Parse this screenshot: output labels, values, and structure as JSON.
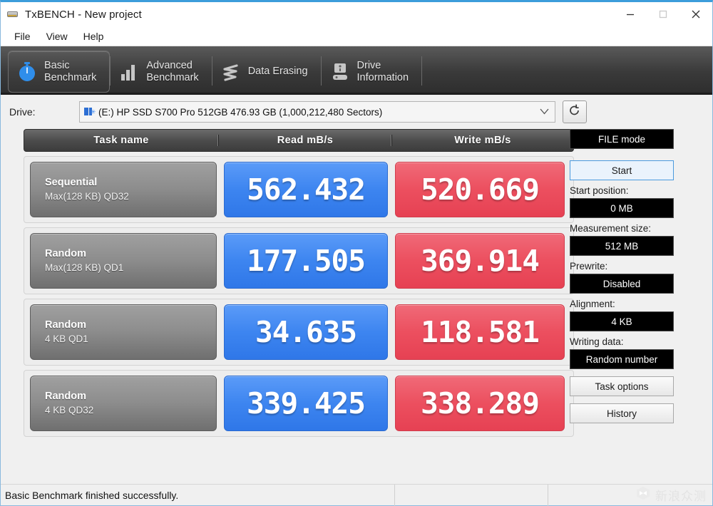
{
  "window": {
    "title": "TxBENCH - New project",
    "app_icon": "hard-disk-icon",
    "controls": {
      "minimize": "minimize-icon",
      "maximize": "maximize-icon",
      "close": "close-icon"
    }
  },
  "menubar": {
    "items": [
      {
        "label": "File"
      },
      {
        "label": "View"
      },
      {
        "label": "Help"
      }
    ]
  },
  "tabs": [
    {
      "label": "Basic\nBenchmark",
      "icon": "stopwatch-icon",
      "active": true
    },
    {
      "label": "Advanced\nBenchmark",
      "icon": "bar-chart-icon",
      "active": false
    },
    {
      "label": "Data Erasing",
      "icon": "scribble-erase-icon",
      "active": false
    },
    {
      "label": "Drive\nInformation",
      "icon": "disk-drive-info-icon",
      "active": false
    }
  ],
  "drive": {
    "label": "Drive:",
    "value": "(E:) HP SSD S700 Pro 512GB  476.93 GB (1,000,212,480 Sectors)",
    "icon": "drive-small-icon",
    "dropdown_icon": "chevron-down-icon",
    "refresh_icon": "refresh-icon"
  },
  "table": {
    "headers": [
      "Task name",
      "Read mB/s",
      "Write mB/s"
    ],
    "rows": [
      {
        "name_line1": "Sequential",
        "name_line2": "Max(128 KB) QD32",
        "read": "562.432",
        "write": "520.669"
      },
      {
        "name_line1": "Random",
        "name_line2": "Max(128 KB) QD1",
        "read": "177.505",
        "write": "369.914"
      },
      {
        "name_line1": "Random",
        "name_line2": "4 KB QD1",
        "read": "34.635",
        "write": "118.581"
      },
      {
        "name_line1": "Random",
        "name_line2": "4 KB QD32",
        "read": "339.425",
        "write": "338.289"
      }
    ]
  },
  "sidebar": {
    "mode_button": "FILE mode",
    "start_button": "Start",
    "fields": [
      {
        "label": "Start position:",
        "value": "0 MB"
      },
      {
        "label": "Measurement size:",
        "value": "512 MB"
      },
      {
        "label": "Prewrite:",
        "value": "Disabled"
      },
      {
        "label": "Alignment:",
        "value": "4 KB"
      },
      {
        "label": "Writing data:",
        "value": "Random number"
      }
    ],
    "task_options_button": "Task options",
    "history_button": "History"
  },
  "statusbar": {
    "message": "Basic Benchmark finished successfully.",
    "watermark_text": "新浪众测",
    "watermark_icon": "cube-logo-icon"
  },
  "colors": {
    "read_blue": "#3d85f0",
    "write_red": "#ec4f5f",
    "accent_border": "#3c9ddb",
    "tab_dark": "#3a3a3a"
  }
}
